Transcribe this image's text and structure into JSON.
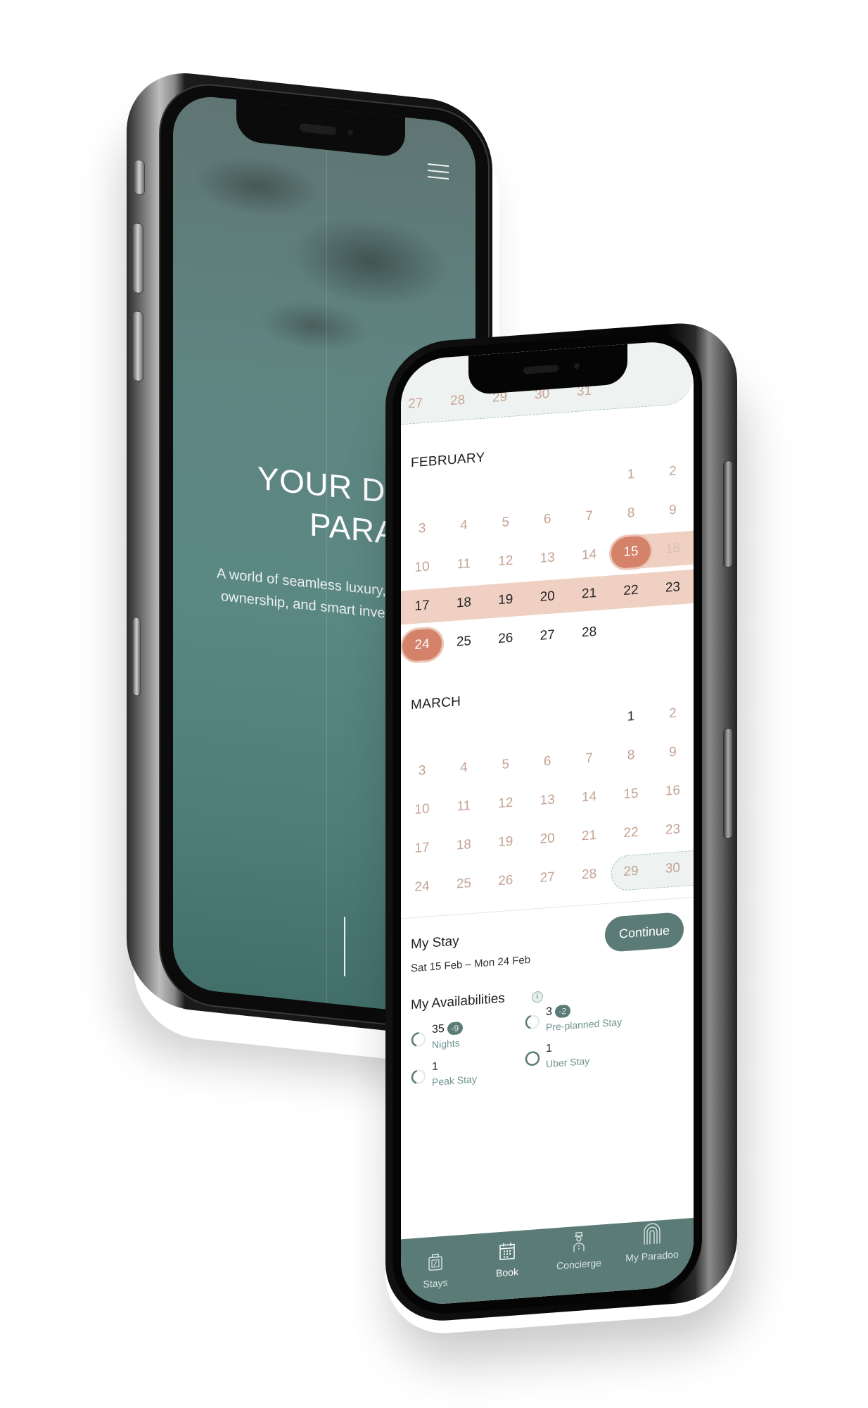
{
  "back_phone": {
    "menu_icon": "hamburger-icon",
    "hero": {
      "title_lines": [
        "YOUR DOOR",
        "PARADIS"
      ],
      "subtitle_lines": [
        "A world of seamless luxury,",
        "ownership, and smart inve"
      ]
    }
  },
  "front_phone": {
    "previous_month_tail": [
      "27",
      "28",
      "29",
      "30",
      "31"
    ],
    "months": [
      {
        "name": "FEBRUARY",
        "rows": [
          [
            "",
            "",
            "",
            "",
            "",
            "1",
            "2"
          ],
          [
            "3",
            "4",
            "5",
            "6",
            "7",
            "8",
            "9"
          ],
          [
            "10",
            "11",
            "12",
            "13",
            "14",
            "15",
            "16"
          ],
          [
            "17",
            "18",
            "19",
            "20",
            "21",
            "22",
            "23"
          ],
          [
            "24",
            "25",
            "26",
            "27",
            "28",
            "",
            ""
          ]
        ]
      },
      {
        "name": "MARCH",
        "rows": [
          [
            "",
            "",
            "",
            "",
            "",
            "1",
            "2"
          ],
          [
            "3",
            "4",
            "5",
            "6",
            "7",
            "8",
            "9"
          ],
          [
            "10",
            "11",
            "12",
            "13",
            "14",
            "15",
            "16"
          ],
          [
            "17",
            "18",
            "19",
            "20",
            "21",
            "22",
            "23"
          ],
          [
            "24",
            "25",
            "26",
            "27",
            "28",
            "29",
            "30"
          ]
        ]
      }
    ],
    "selection": {
      "start": "15",
      "end": "24",
      "month": "FEBRUARY"
    },
    "my_stay": {
      "title": "My Stay",
      "dates": "Sat 15 Feb – Mon 24 Feb",
      "continue_label": "Continue"
    },
    "availabilities": {
      "title": "My Availabilities",
      "info_icon": "i",
      "items": [
        {
          "value": "35",
          "delta": "-9",
          "label": "Nights",
          "fraction": 0.45
        },
        {
          "value": "3",
          "delta": "-2",
          "label": "Pre-planned Stay",
          "fraction": 0.4
        },
        {
          "value": "1",
          "delta": "",
          "label": "Peak Stay",
          "fraction": 0.4
        },
        {
          "value": "1",
          "delta": "",
          "label": "Uber Stay",
          "fraction": 1.0
        }
      ]
    },
    "bottom_nav": [
      {
        "label": "Stays",
        "icon": "suitcase-icon",
        "active": false
      },
      {
        "label": "Book",
        "icon": "calendar-icon",
        "active": true
      },
      {
        "label": "Concierge",
        "icon": "concierge-icon",
        "active": false
      },
      {
        "label": "My Paradoo",
        "icon": "arch-icon",
        "active": false
      }
    ],
    "colors": {
      "accent": "#5b7b77",
      "selected": "#d4826a",
      "range": "#efd0c2",
      "day_text": "#c4a393"
    }
  }
}
